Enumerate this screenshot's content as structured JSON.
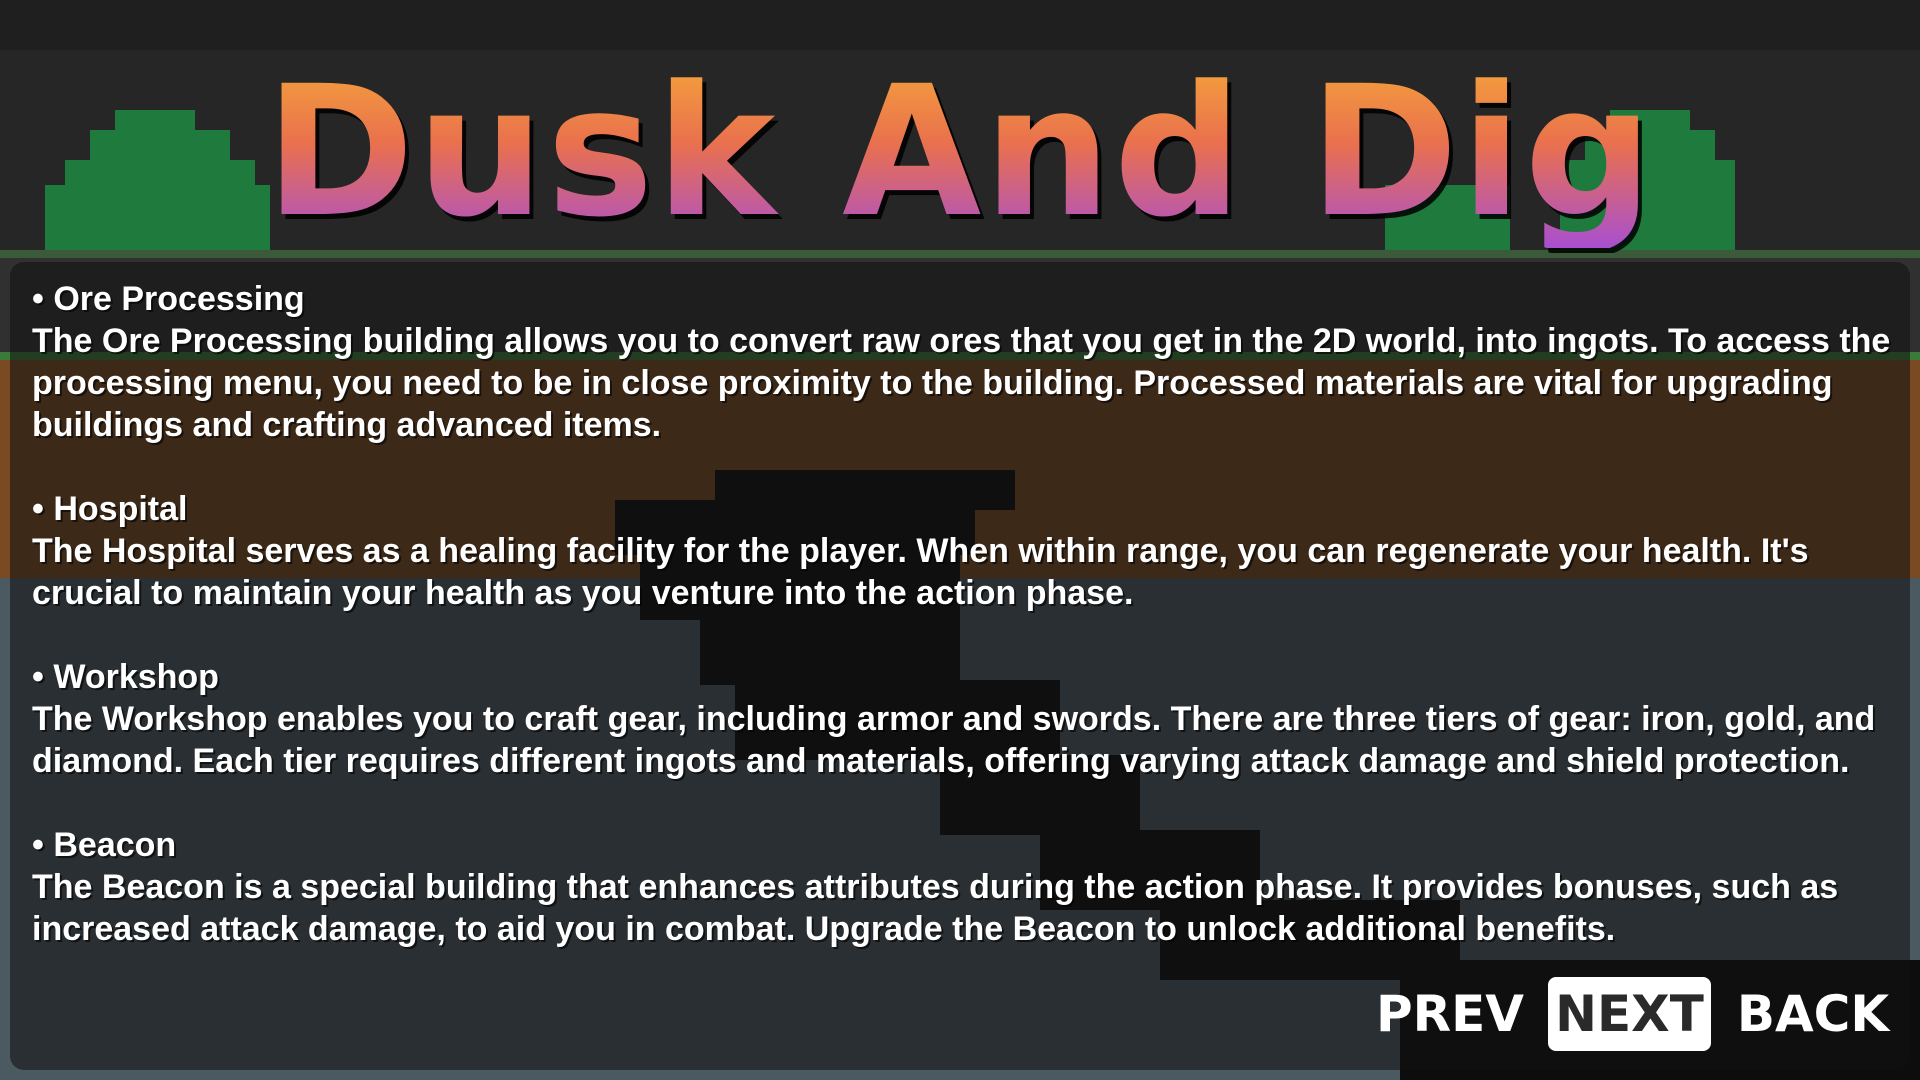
{
  "game": {
    "title": "Dusk And Dig"
  },
  "sections": [
    {
      "heading": "• Ore Processing",
      "description": "The Ore Processing building allows you to convert raw ores that you get in the 2D world, into ingots. To access the processing menu, you need to be in close proximity to the building. Processed materials are vital for upgrading buildings and crafting advanced items."
    },
    {
      "heading": "• Hospital",
      "description": "The Hospital serves as a healing facility for the player. When within range, you can regenerate your health. It's crucial to maintain your health as you venture into the action phase."
    },
    {
      "heading": "• Workshop",
      "description": "The Workshop enables you to craft gear, including armor and swords. There are three tiers of gear: iron, gold, and diamond. Each tier requires different ingots and materials, offering varying attack damage and shield protection."
    },
    {
      "heading": "• Beacon",
      "description": "The Beacon is a special building that enhances attributes during the action phase. It provides bonuses, such as increased attack damage, to aid you in combat. Upgrade the Beacon to unlock additional benefits."
    }
  ],
  "navigation": {
    "prev_label": "PREV",
    "next_label": "NEXT",
    "back_label": "BACK",
    "selected": "NEXT"
  },
  "colors": {
    "title_gradient_top": "#f5a53a",
    "title_gradient_bottom": "#a84fd0",
    "panel": "#121212",
    "text": "#ffffff",
    "dirt": "#7a4a22",
    "stone": "#4a5a60",
    "tree": "#1f7a3e"
  }
}
